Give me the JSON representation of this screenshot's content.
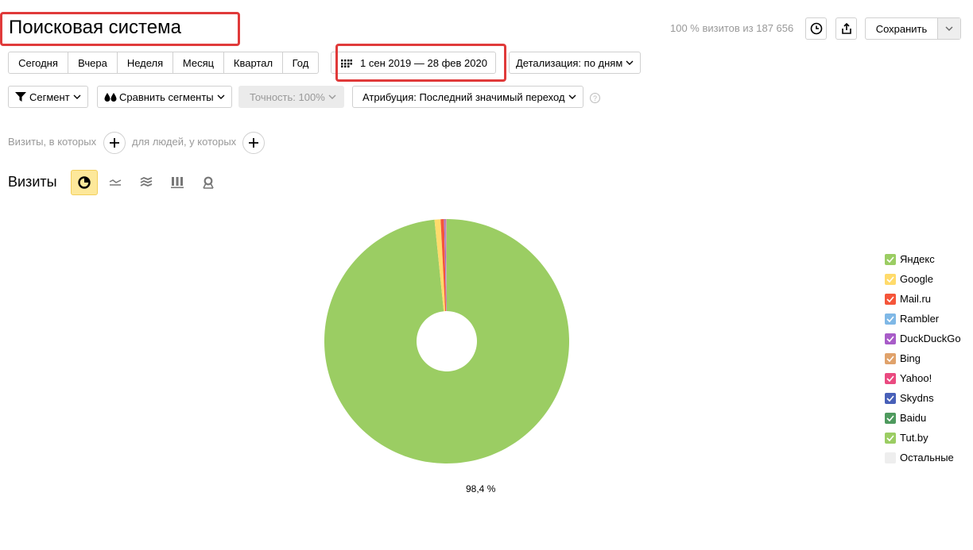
{
  "header": {
    "title": "Поисковая система",
    "visits_info": "100 % визитов из 187 656",
    "save_label": "Сохранить"
  },
  "period": {
    "buttons": [
      "Сегодня",
      "Вчера",
      "Неделя",
      "Месяц",
      "Квартал",
      "Год"
    ],
    "date_range": "1 сен 2019 — 28 фев 2020",
    "detail": "Детализация: по дням"
  },
  "filters": {
    "segment": "Сегмент",
    "compare": "Сравнить сегменты",
    "accuracy": "Точность: 100%",
    "attribution": "Атрибуция: Последний значимый переход",
    "help": "?"
  },
  "conditions": {
    "visits_label": "Визиты, в которых",
    "people_label": "для людей, у которых"
  },
  "chart_header": {
    "title": "Визиты",
    "views": [
      "pie-view-icon",
      "line-view-icon",
      "area-view-icon",
      "bar-view-icon",
      "map-view-icon"
    ]
  },
  "chart_data": {
    "type": "pie",
    "donut": true,
    "label": "98,4 %",
    "slices": [
      {
        "name": "Яндекс",
        "value": 98.4,
        "color": "#9bcd63"
      },
      {
        "name": "Google",
        "value": 0.8,
        "color": "#ffdb6b"
      },
      {
        "name": "Mail.ru",
        "value": 0.45,
        "color": "#f5553a"
      },
      {
        "name": "Rambler",
        "value": 0.05,
        "color": "#7fb8e6"
      },
      {
        "name": "DuckDuckGo",
        "value": 0.15,
        "color": "#a85cc8"
      },
      {
        "name": "Bing",
        "value": 0.08,
        "color": "#e0a26b"
      },
      {
        "name": "Yahoo!",
        "value": 0.02,
        "color": "#ea4a80"
      },
      {
        "name": "Skydns",
        "value": 0.02,
        "color": "#4860b8"
      },
      {
        "name": "Baidu",
        "value": 0.01,
        "color": "#4e9a5e"
      },
      {
        "name": "Tut.by",
        "value": 0.01,
        "color": "#9bcd63"
      },
      {
        "name": "Остальные",
        "value": 0.01,
        "color": "#eeeeee"
      }
    ]
  }
}
